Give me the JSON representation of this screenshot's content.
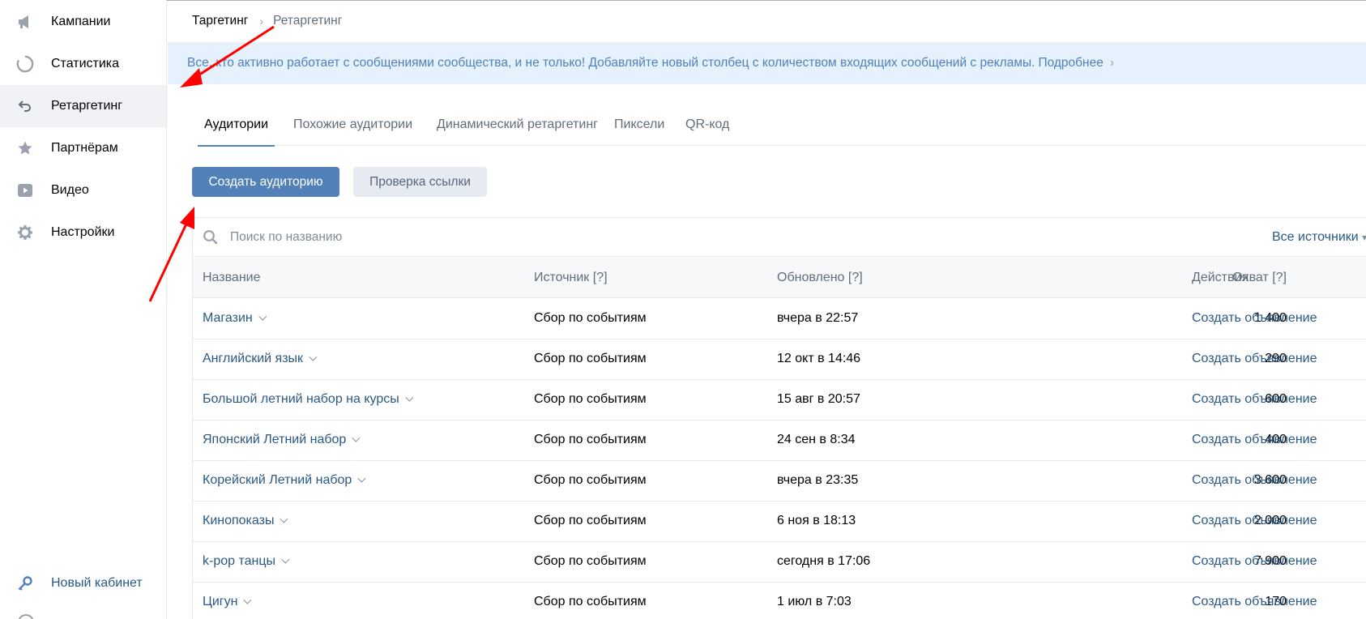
{
  "sidebar": {
    "items": [
      {
        "label": "Кампании",
        "icon": "megaphone-icon"
      },
      {
        "label": "Статистика",
        "icon": "stats-circle-icon"
      },
      {
        "label": "Ретаргетинг",
        "icon": "retarget-arrow-icon"
      },
      {
        "label": "Партнёрам",
        "icon": "star-icon"
      },
      {
        "label": "Видео",
        "icon": "video-icon"
      },
      {
        "label": "Настройки",
        "icon": "gear-icon"
      }
    ],
    "active_index": 2,
    "new_cabinet_label": "Новый кабинет"
  },
  "breadcrumb": {
    "parent": "Таргетинг",
    "separator": "›",
    "current": "Ретаргетинг"
  },
  "banner": {
    "text": "Все, кто активно работает с сообщениями сообщества, и не только! Добавляйте новый столбец с количеством входящих сообщений с рекламы.",
    "link": "Подробнее",
    "chevron": "›"
  },
  "tabs": [
    {
      "label": "Аудитории",
      "active": true
    },
    {
      "label": "Похожие аудитории",
      "active": false
    },
    {
      "label": "Динамический ретаргетинг",
      "active": false
    },
    {
      "label": "Пиксели",
      "active": false
    },
    {
      "label": "QR-код",
      "active": false
    }
  ],
  "buttons": {
    "create": "Создать аудиторию",
    "check_link": "Проверка ссылки"
  },
  "search": {
    "placeholder": "Поиск по названию",
    "value": ""
  },
  "filter": {
    "sources_label": "Все источники"
  },
  "table": {
    "headers": {
      "name": "Название",
      "source": "Источник [?]",
      "updated": "Обновлено [?]",
      "reach": "Охват [?]",
      "actions": "Действия"
    },
    "rows": [
      {
        "name": "Магазин",
        "source": "Сбор по событиям",
        "updated": "вчера в 22:57",
        "reach": "1 400",
        "action": "Создать объявление"
      },
      {
        "name": "Английский язык",
        "source": "Сбор по событиям",
        "updated": "12 окт в 14:46",
        "reach": "290",
        "action": "Создать объявление"
      },
      {
        "name": "Большой летний набор на курсы",
        "source": "Сбор по событиям",
        "updated": "15 авг в 20:57",
        "reach": "600",
        "action": "Создать объявление"
      },
      {
        "name": "Японский Летний набор",
        "source": "Сбор по событиям",
        "updated": "24 сен в 8:34",
        "reach": "400",
        "action": "Создать объявление"
      },
      {
        "name": "Корейский Летний набор",
        "source": "Сбор по событиям",
        "updated": "вчера в 23:35",
        "reach": "3 600",
        "action": "Создать объявление"
      },
      {
        "name": "Кинопоказы",
        "source": "Сбор по событиям",
        "updated": "6 ноя в 18:13",
        "reach": "2 000",
        "action": "Создать объявление"
      },
      {
        "name": "k-pop танцы",
        "source": "Сбор по событиям",
        "updated": "сегодня в 17:06",
        "reach": "7 900",
        "action": "Создать объявление"
      },
      {
        "name": "Цигун",
        "source": "Сбор по событиям",
        "updated": "1 июл в 7:03",
        "reach": "170",
        "action": "Создать объявление"
      }
    ]
  },
  "colors": {
    "accent": "#5181b8",
    "link": "#2a5885",
    "banner_bg": "#e5f1fc",
    "annotation_arrow": "#ff0000"
  }
}
